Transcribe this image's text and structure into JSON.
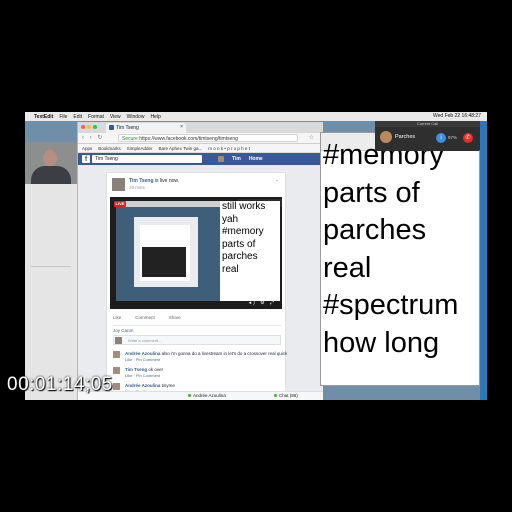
{
  "menubar": {
    "app": "TextEdit",
    "items": [
      "File",
      "Edit",
      "Format",
      "View",
      "Window",
      "Help"
    ],
    "status": "Wed Feb 22  16:48:27"
  },
  "browser": {
    "tab_title": "Tim Tseng",
    "url_secure": "Secure",
    "url": "https://www.facebook.com/timtseng/timtseng",
    "bookmarks": [
      "Apps",
      "Bookmarks",
      "SimpleAdder",
      "Bare Aphex Twin ga...",
      "m o n k • p r o p h e t"
    ]
  },
  "facebook": {
    "search_value": "Tim Tseng",
    "nav": {
      "user": "Tim",
      "home": "Home"
    },
    "post": {
      "author": "Tim Tseng",
      "status": "is live now.",
      "time": "28 mins · ",
      "live_badge": "LIVE",
      "video_text": "still works\nyah\n#memory\nparts of\nparches\nreal",
      "actions": [
        "Like",
        "Comment",
        "Share"
      ],
      "reactions": "Joy Caron",
      "comment_placeholder": "Write a comment...",
      "comments": [
        {
          "author": "Andrée Azoulina",
          "text": " also i'm gonna do a livestream in let's do a crossover real quick",
          "meta": "Like · Pin Comment"
        },
        {
          "author": "Tim Tseng",
          "text": " ok over",
          "meta": "Like · Pin Comment"
        },
        {
          "author": "Andrée Azoulina",
          "text": " tinyme",
          "meta": "Like · Pin Comment"
        }
      ]
    },
    "chatbar": {
      "contact": "Andrée Azoulina",
      "chat": "Chat (86)"
    }
  },
  "textedit": {
    "text": "#memory\nparts of\nparches\nreal\n#spectrum\nhow long"
  },
  "notification": {
    "header": "Current Call",
    "caller": "Parches",
    "percent": "97%"
  },
  "overlay": {
    "timecode": "00:01:14;05"
  },
  "colors": {
    "facebook_blue": "#3b5998",
    "live_red": "#e02020",
    "decline_red": "#e0302a",
    "info_blue": "#3b8ee0"
  }
}
